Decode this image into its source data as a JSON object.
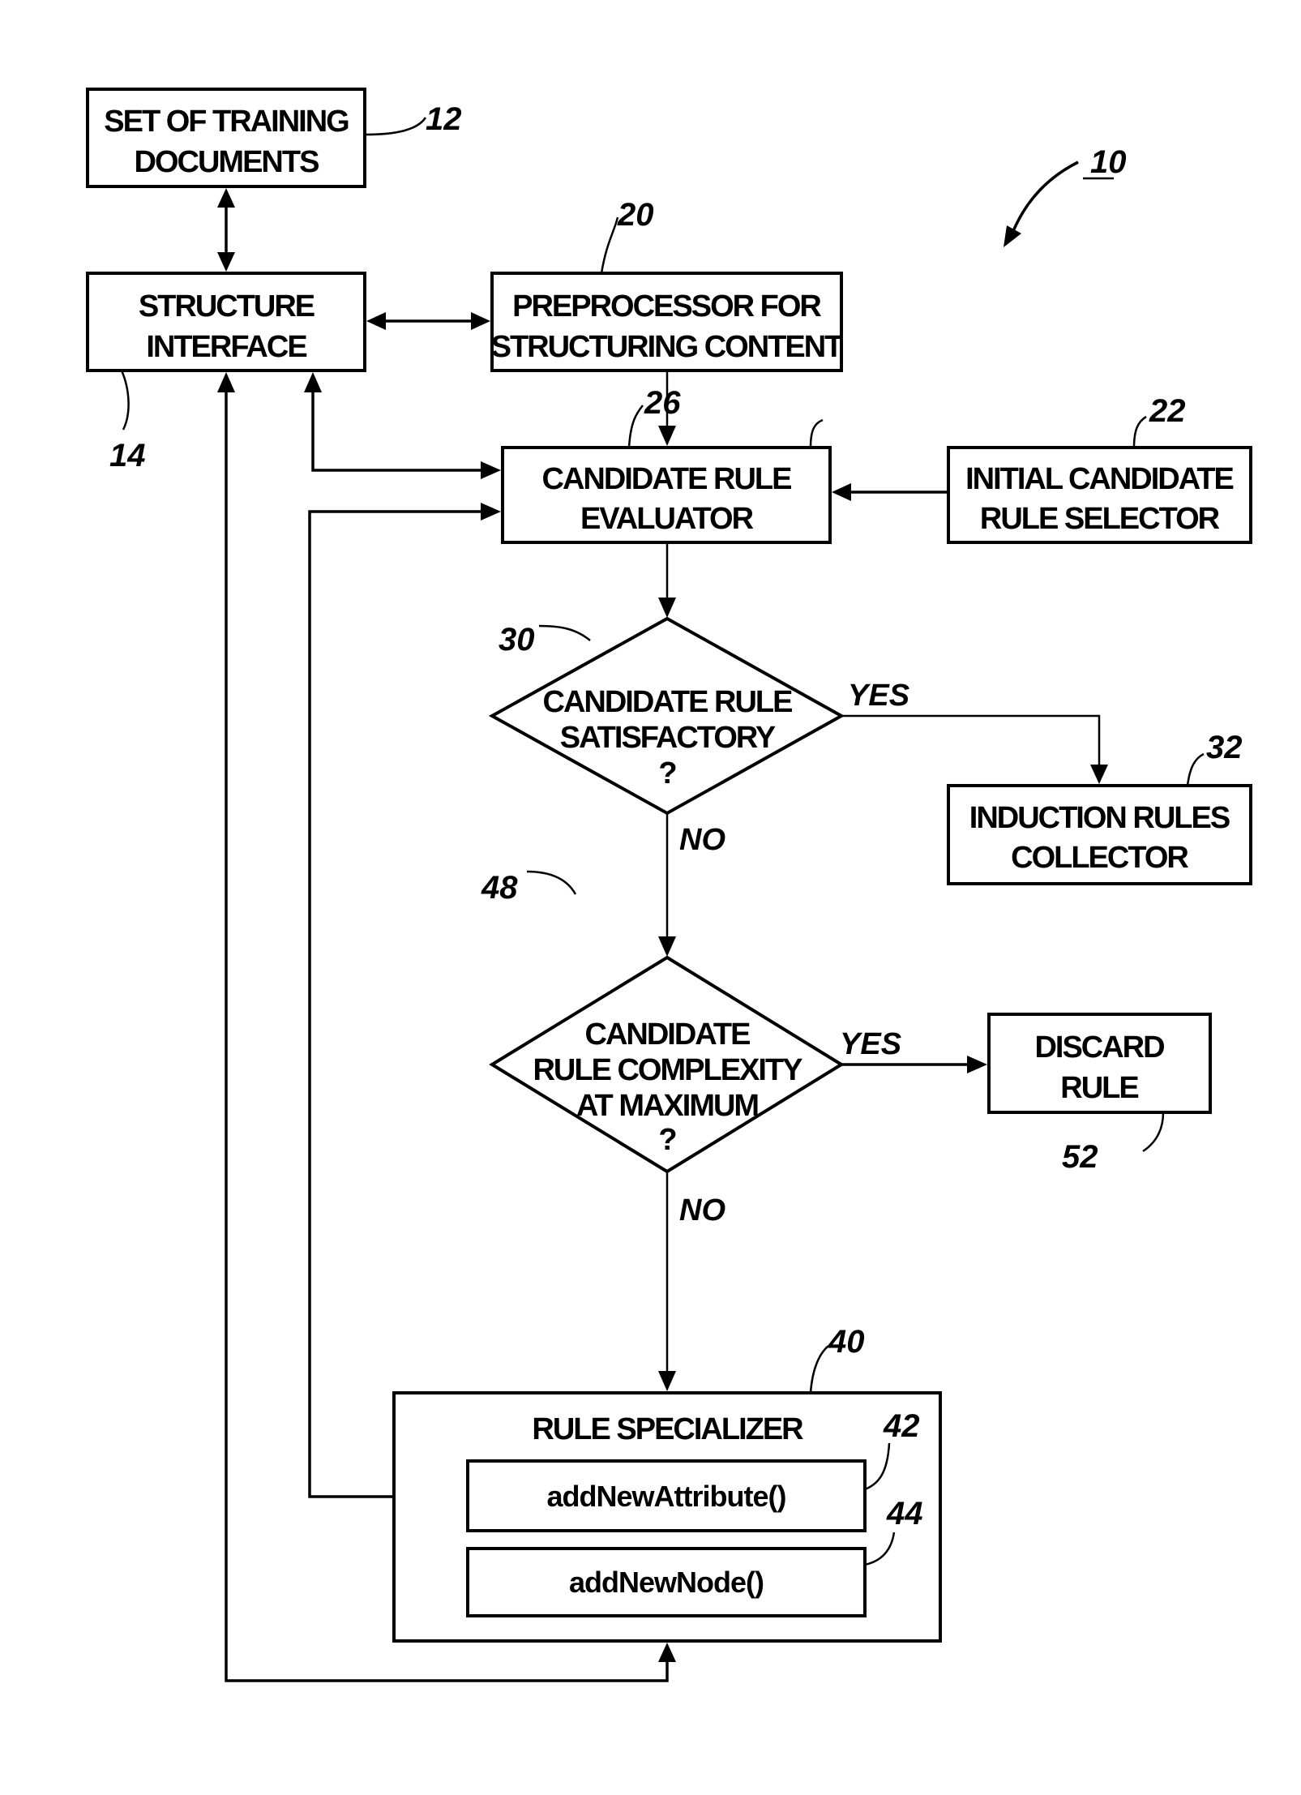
{
  "figure": {
    "ref": "10"
  },
  "nodes": {
    "training_docs": {
      "ref": "12",
      "lines": [
        "SET OF TRAINING",
        "DOCUMENTS"
      ]
    },
    "structure_interface": {
      "ref": "14",
      "lines": [
        "STRUCTURE",
        "INTERFACE"
      ]
    },
    "preprocessor": {
      "ref": "20",
      "lines": [
        "PREPROCESSOR FOR",
        "STRUCTURING CONTENT"
      ]
    },
    "initial_selector": {
      "ref": "22",
      "lines": [
        "INITIAL CANDIDATE",
        "RULE SELECTOR"
      ]
    },
    "evaluator": {
      "ref": "26",
      "lines": [
        "CANDIDATE RULE",
        "EVALUATOR"
      ]
    },
    "satisfactory_decision": {
      "ref": "30",
      "lines": [
        "CANDIDATE RULE",
        "SATISFACTORY",
        "?"
      ]
    },
    "induction_collector": {
      "ref": "32",
      "lines": [
        "INDUCTION RULES",
        "COLLECTOR"
      ]
    },
    "complexity_decision": {
      "ref": "48",
      "lines": [
        "CANDIDATE",
        "RULE COMPLEXITY",
        "AT MAXIMUM",
        "?"
      ]
    },
    "discard_rule": {
      "ref": "52",
      "lines": [
        "DISCARD",
        "RULE"
      ]
    },
    "rule_specializer": {
      "ref": "40",
      "title": "RULE SPECIALIZER"
    },
    "add_new_attribute": {
      "ref": "42",
      "label": "addNewAttribute()"
    },
    "add_new_node": {
      "ref": "44",
      "label": "addNewNode()"
    }
  },
  "edge_labels": {
    "sat_yes": "YES",
    "sat_no": "NO",
    "cx_yes": "YES",
    "cx_no": "NO"
  }
}
